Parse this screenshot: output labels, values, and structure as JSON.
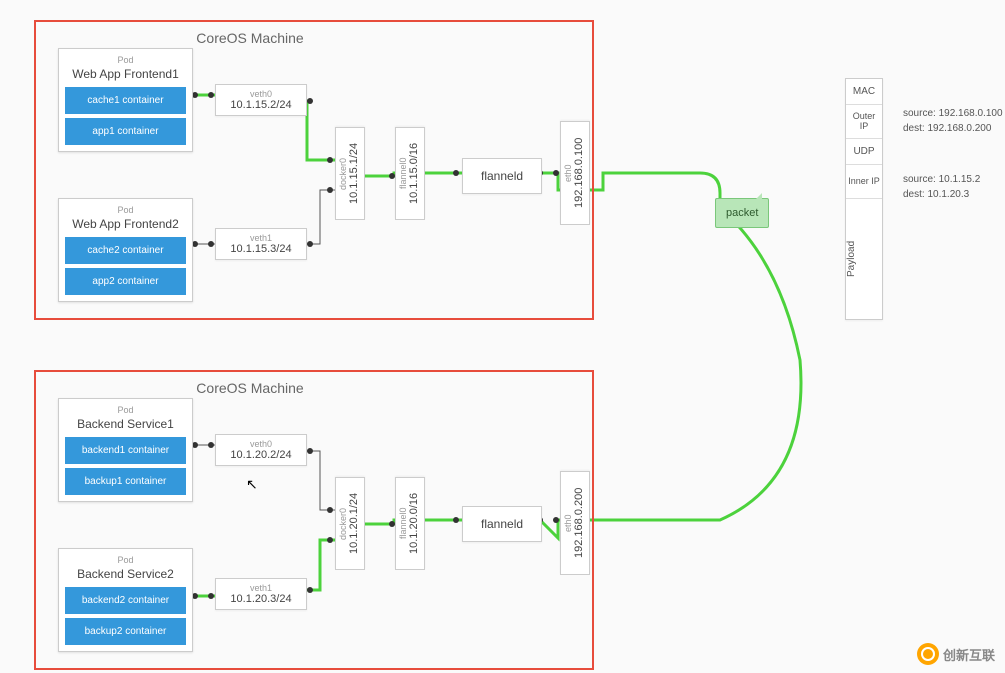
{
  "machine1": {
    "title": "CoreOS Machine"
  },
  "machine2": {
    "title": "CoreOS Machine"
  },
  "pod1": {
    "label": "Pod",
    "title": "Web App Frontend1",
    "c1": "cache1 container",
    "c2": "app1 container"
  },
  "pod2": {
    "label": "Pod",
    "title": "Web App Frontend2",
    "c1": "cache2 container",
    "c2": "app2 container"
  },
  "pod3": {
    "label": "Pod",
    "title": "Backend Service1",
    "c1": "backend1 container",
    "c2": "backup1 container"
  },
  "pod4": {
    "label": "Pod",
    "title": "Backend Service2",
    "c1": "backend2 container",
    "c2": "backup2 container"
  },
  "veth_m1_0": {
    "name": "veth0",
    "ip": "10.1.15.2/24"
  },
  "veth_m1_1": {
    "name": "veth1",
    "ip": "10.1.15.3/24"
  },
  "veth_m2_0": {
    "name": "veth0",
    "ip": "10.1.20.2/24"
  },
  "veth_m2_1": {
    "name": "veth1",
    "ip": "10.1.20.3/24"
  },
  "docker_m1": {
    "name": "docker0",
    "ip": "10.1.15.1/24"
  },
  "docker_m2": {
    "name": "docker0",
    "ip": "10.1.20.1/24"
  },
  "flannel_if_m1": {
    "name": "flannel0",
    "ip": "10.1.15.0/16"
  },
  "flannel_if_m2": {
    "name": "flannel0",
    "ip": "10.1.20.0/16"
  },
  "flanneld_m1": "flanneld",
  "flanneld_m2": "flanneld",
  "eth_m1": {
    "name": "eth0",
    "ip": "192.168.0.100"
  },
  "eth_m2": {
    "name": "eth0",
    "ip": "192.168.0.200"
  },
  "packet": "packet",
  "stack": {
    "mac": "MAC",
    "outerip": "Outer IP",
    "udp": "UDP",
    "innerip": "Inner IP",
    "payload": "Payload"
  },
  "outer_info": {
    "src": "source: 192.168.0.100",
    "dst": "dest: 192.168.0.200"
  },
  "inner_info": {
    "src": "source: 10.1.15.2",
    "dst": "dest: 10.1.20.3"
  },
  "watermark": "创新互联"
}
